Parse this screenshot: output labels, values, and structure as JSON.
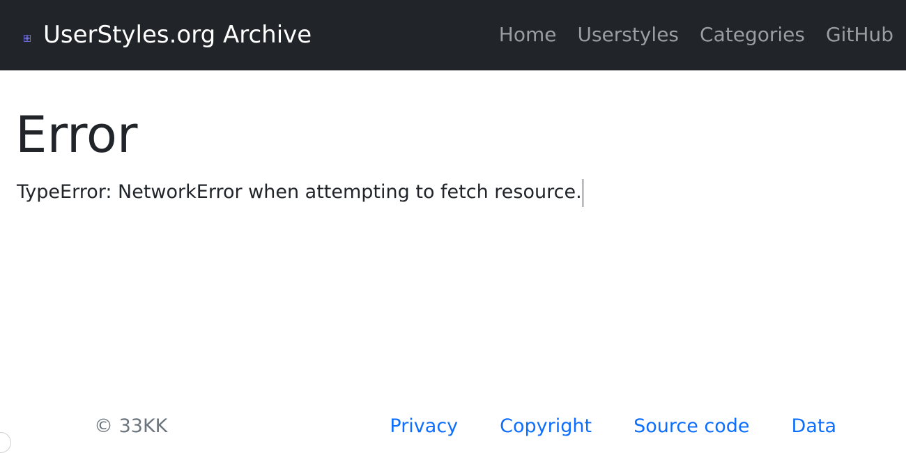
{
  "navbar": {
    "brand_icon": "broken-image-icon",
    "brand_title": "UserStyles.org Archive",
    "links": [
      {
        "label": "Home"
      },
      {
        "label": "Userstyles"
      },
      {
        "label": "Categories"
      },
      {
        "label": "GitHub"
      }
    ]
  },
  "main": {
    "heading": "Error",
    "message": "TypeError: NetworkError when attempting to fetch resource."
  },
  "footer": {
    "copyright": "© 33KK",
    "links": [
      {
        "label": "Privacy"
      },
      {
        "label": "Copyright"
      },
      {
        "label": "Source code"
      },
      {
        "label": "Data"
      }
    ]
  },
  "colors": {
    "navbar_bg": "#212529",
    "nav_link": "#9a9da1",
    "footer_link": "#0d6efd",
    "muted_text": "#6c757d"
  }
}
